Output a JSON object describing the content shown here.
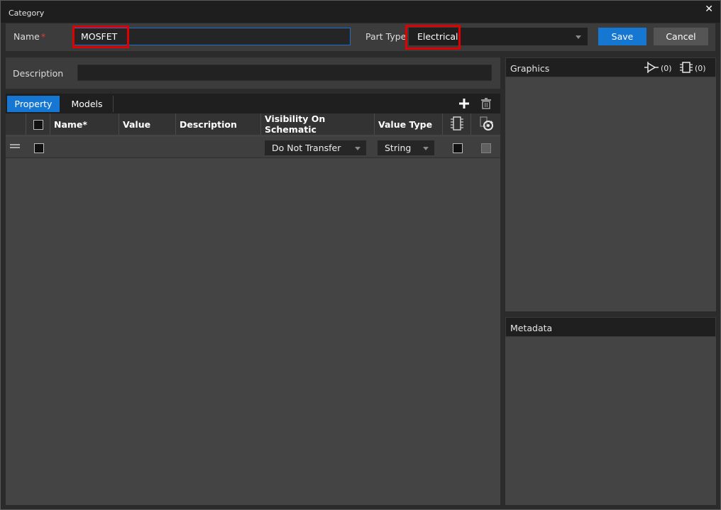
{
  "window": {
    "title": "Category",
    "close_icon": "close-icon"
  },
  "header": {
    "name_label": "Name",
    "required_mark": "*",
    "name_value": "MOSFET",
    "part_type_label": "Part Type",
    "part_type_value": "Electrical",
    "save_label": "Save",
    "cancel_label": "Cancel"
  },
  "description": {
    "label": "Description",
    "value": ""
  },
  "tabs": [
    {
      "label": "Property",
      "active": true
    },
    {
      "label": "Models",
      "active": false
    }
  ],
  "toolbar": {
    "add_icon": "plus-icon",
    "delete_icon": "trash-icon"
  },
  "table": {
    "columns": [
      "Name*",
      "Value",
      "Description",
      "Visibility On Schematic",
      "Value Type"
    ],
    "rows": [
      {
        "name": "",
        "value": "",
        "description": "",
        "visibility": "Do Not Transfer",
        "value_type": "String"
      }
    ]
  },
  "graphics": {
    "title": "Graphics",
    "symbol_count": "(0)",
    "footprint_count": "(0)"
  },
  "metadata": {
    "title": "Metadata"
  },
  "colors": {
    "accent": "#1677d2",
    "highlight": "#e00000",
    "required": "#e03b3b"
  }
}
